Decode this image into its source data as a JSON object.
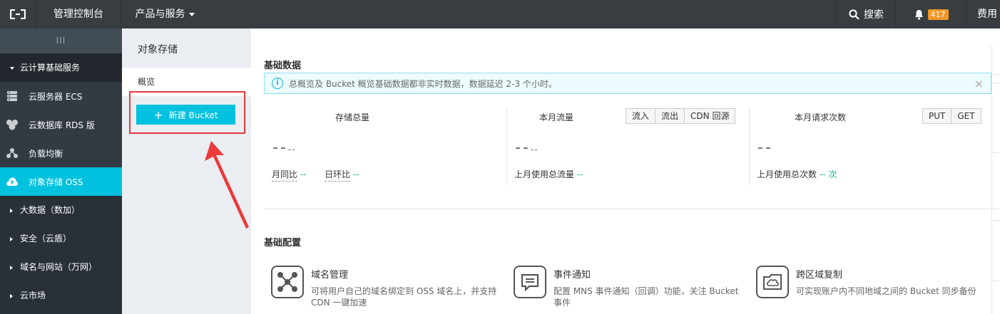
{
  "topbar": {
    "logo": "aliyun-logo",
    "console": "管理控制台",
    "products": "产品与服务",
    "search": "搜索",
    "notifications": "417",
    "fee": "费用"
  },
  "sidebar": {
    "collapse": "III",
    "group": "云计算基础服务",
    "items": [
      {
        "label": "云服务器 ECS",
        "icon": "server-icon"
      },
      {
        "label": "云数据库 RDS 版",
        "icon": "database-icon"
      },
      {
        "label": "负载均衡",
        "icon": "load-balancer-icon"
      },
      {
        "label": "对象存储 OSS",
        "icon": "cloud-upload-icon",
        "active": true
      }
    ],
    "subs": [
      "大数据（数加）",
      "安全（云盾）",
      "域名与网站（万网）",
      "云市场"
    ]
  },
  "subnav": {
    "title": "对象存储",
    "overview": "概览",
    "new_bucket": "新建 Bucket"
  },
  "main": {
    "basic_data_title": "基础数据",
    "notice": "总概览及 Bucket 概览基础数据都非实时数据，数据延迟 2-3 个小时。",
    "storage": {
      "label": "存储总量",
      "value": "--",
      "unit": "--",
      "yoy_label": "月同比",
      "yoy_value": "--",
      "mom_label": "日环比",
      "mom_value": "--"
    },
    "traffic": {
      "label": "本月流量",
      "tabs": [
        "流入",
        "流出",
        "CDN 回源"
      ],
      "value": "--",
      "unit": "--",
      "foot_label": "上月使用总流量",
      "foot_value": "--"
    },
    "requests": {
      "label": "本月请求次数",
      "tabs": [
        "PUT",
        "GET"
      ],
      "value": "--",
      "foot_label": "上月使用总次数",
      "foot_value": "--",
      "foot_unit": "次"
    },
    "basic_config_title": "基础配置",
    "configs": [
      {
        "name": "域名管理",
        "desc": "可将用户自己的域名绑定到 OSS 域名上，并支持 CDN 一键加速",
        "icon": "domain-icon"
      },
      {
        "name": "事件通知",
        "desc": "配置 MNS 事件通知（回调）功能，关注 Bucket 事件",
        "icon": "event-notification-icon"
      },
      {
        "name": "跨区域复制",
        "desc": "可实现账户内不同地域之间的 Bucket 同步备份",
        "icon": "cross-region-replication-icon"
      }
    ]
  },
  "colors": {
    "topbar": "#373d41",
    "sidebar": "#293038",
    "accent": "#00c1de",
    "badge": "#f39826",
    "annotation": "#e83a3a"
  }
}
